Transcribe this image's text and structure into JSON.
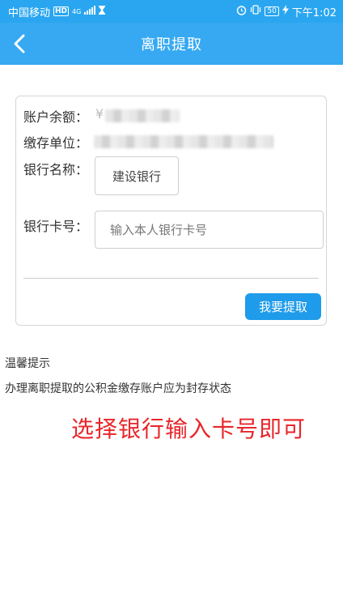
{
  "status_bar": {
    "carrier": "中国移动",
    "hd_badge": "HD",
    "network": "4G",
    "battery": "50",
    "time": "下午1:02"
  },
  "header": {
    "title": "离职提取",
    "back_icon": "chevron-left-icon"
  },
  "form": {
    "balance_label": "账户余额：",
    "balance_value_partial": "¥",
    "employer_label": "缴存单位：",
    "bank_name_label": "银行名称：",
    "bank_name_value": "建设银行",
    "card_number_label": "银行卡号：",
    "card_number_placeholder": "输入本人银行卡号",
    "card_number_value": "",
    "submit_label": "我要提取"
  },
  "tips": {
    "title": "温馨提示",
    "text": "办理离职提取的公积金缴存账户应为封存状态"
  },
  "annotation": "选择银行输入卡号即可",
  "colors": {
    "primary": "#36a9f2",
    "button": "#1e9bea",
    "annotation": "#e8262a"
  }
}
